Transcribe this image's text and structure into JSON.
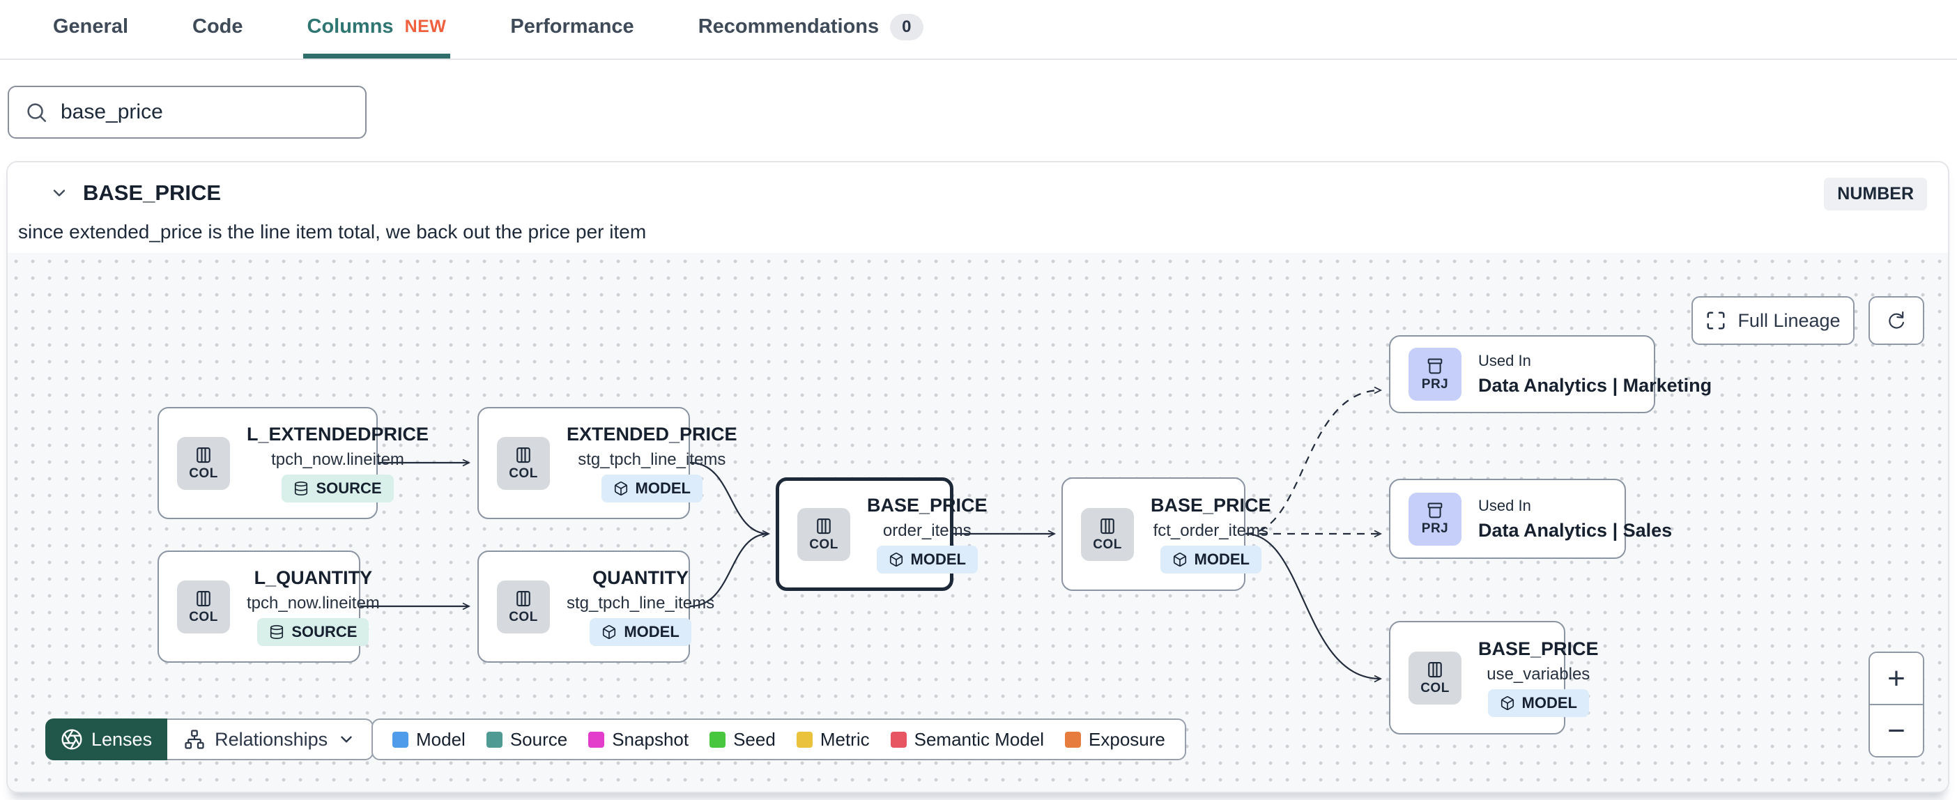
{
  "tabs": {
    "items": [
      {
        "label": "General"
      },
      {
        "label": "Code"
      },
      {
        "label": "Columns",
        "badge": "NEW"
      },
      {
        "label": "Performance"
      },
      {
        "label": "Recommendations",
        "count": "0"
      }
    ]
  },
  "search": {
    "value": "base_price"
  },
  "column_panel": {
    "name": "BASE_PRICE",
    "type": "NUMBER",
    "description": "since extended_price is the line item total, we back out the price per item"
  },
  "lineage": {
    "toolbar": {
      "full_lineage": "Full Lineage"
    },
    "nodes": [
      {
        "chip": "COL",
        "title": "L_EXTENDEDPRICE",
        "subtitle": "tpch_now.lineitem",
        "badge": "SOURCE"
      },
      {
        "chip": "COL",
        "title": "L_QUANTITY",
        "subtitle": "tpch_now.lineitem",
        "badge": "SOURCE"
      },
      {
        "chip": "COL",
        "title": "EXTENDED_PRICE",
        "subtitle": "stg_tpch_line_items",
        "badge": "MODEL"
      },
      {
        "chip": "COL",
        "title": "QUANTITY",
        "subtitle": "stg_tpch_line_items",
        "badge": "MODEL"
      },
      {
        "chip": "COL",
        "title": "BASE_PRICE",
        "subtitle": "order_items",
        "badge": "MODEL"
      },
      {
        "chip": "COL",
        "title": "BASE_PRICE",
        "subtitle": "fct_order_items",
        "badge": "MODEL"
      },
      {
        "chip": "PRJ",
        "eyebrow": "Used In",
        "title": "Data Analytics | Marketing"
      },
      {
        "chip": "PRJ",
        "eyebrow": "Used In",
        "title": "Data Analytics | Sales"
      },
      {
        "chip": "COL",
        "title": "BASE_PRICE",
        "subtitle": "use_variables",
        "badge": "MODEL"
      }
    ],
    "controls": {
      "lenses": "Lenses",
      "relationships": "Relationships",
      "zoom_in": "+",
      "zoom_out": "−"
    },
    "legend": [
      {
        "label": "Model",
        "color": "#4f9cea"
      },
      {
        "label": "Source",
        "color": "#4f9a92"
      },
      {
        "label": "Snapshot",
        "color": "#e23ecb"
      },
      {
        "label": "Seed",
        "color": "#47c63e"
      },
      {
        "label": "Metric",
        "color": "#eac23b"
      },
      {
        "label": "Semantic Model",
        "color": "#e65561"
      },
      {
        "label": "Exposure",
        "color": "#e67c3e"
      }
    ]
  },
  "colors": {
    "accent_teal": "#2f7673",
    "new_badge": "#f0603f",
    "edge": "#222c3d"
  }
}
